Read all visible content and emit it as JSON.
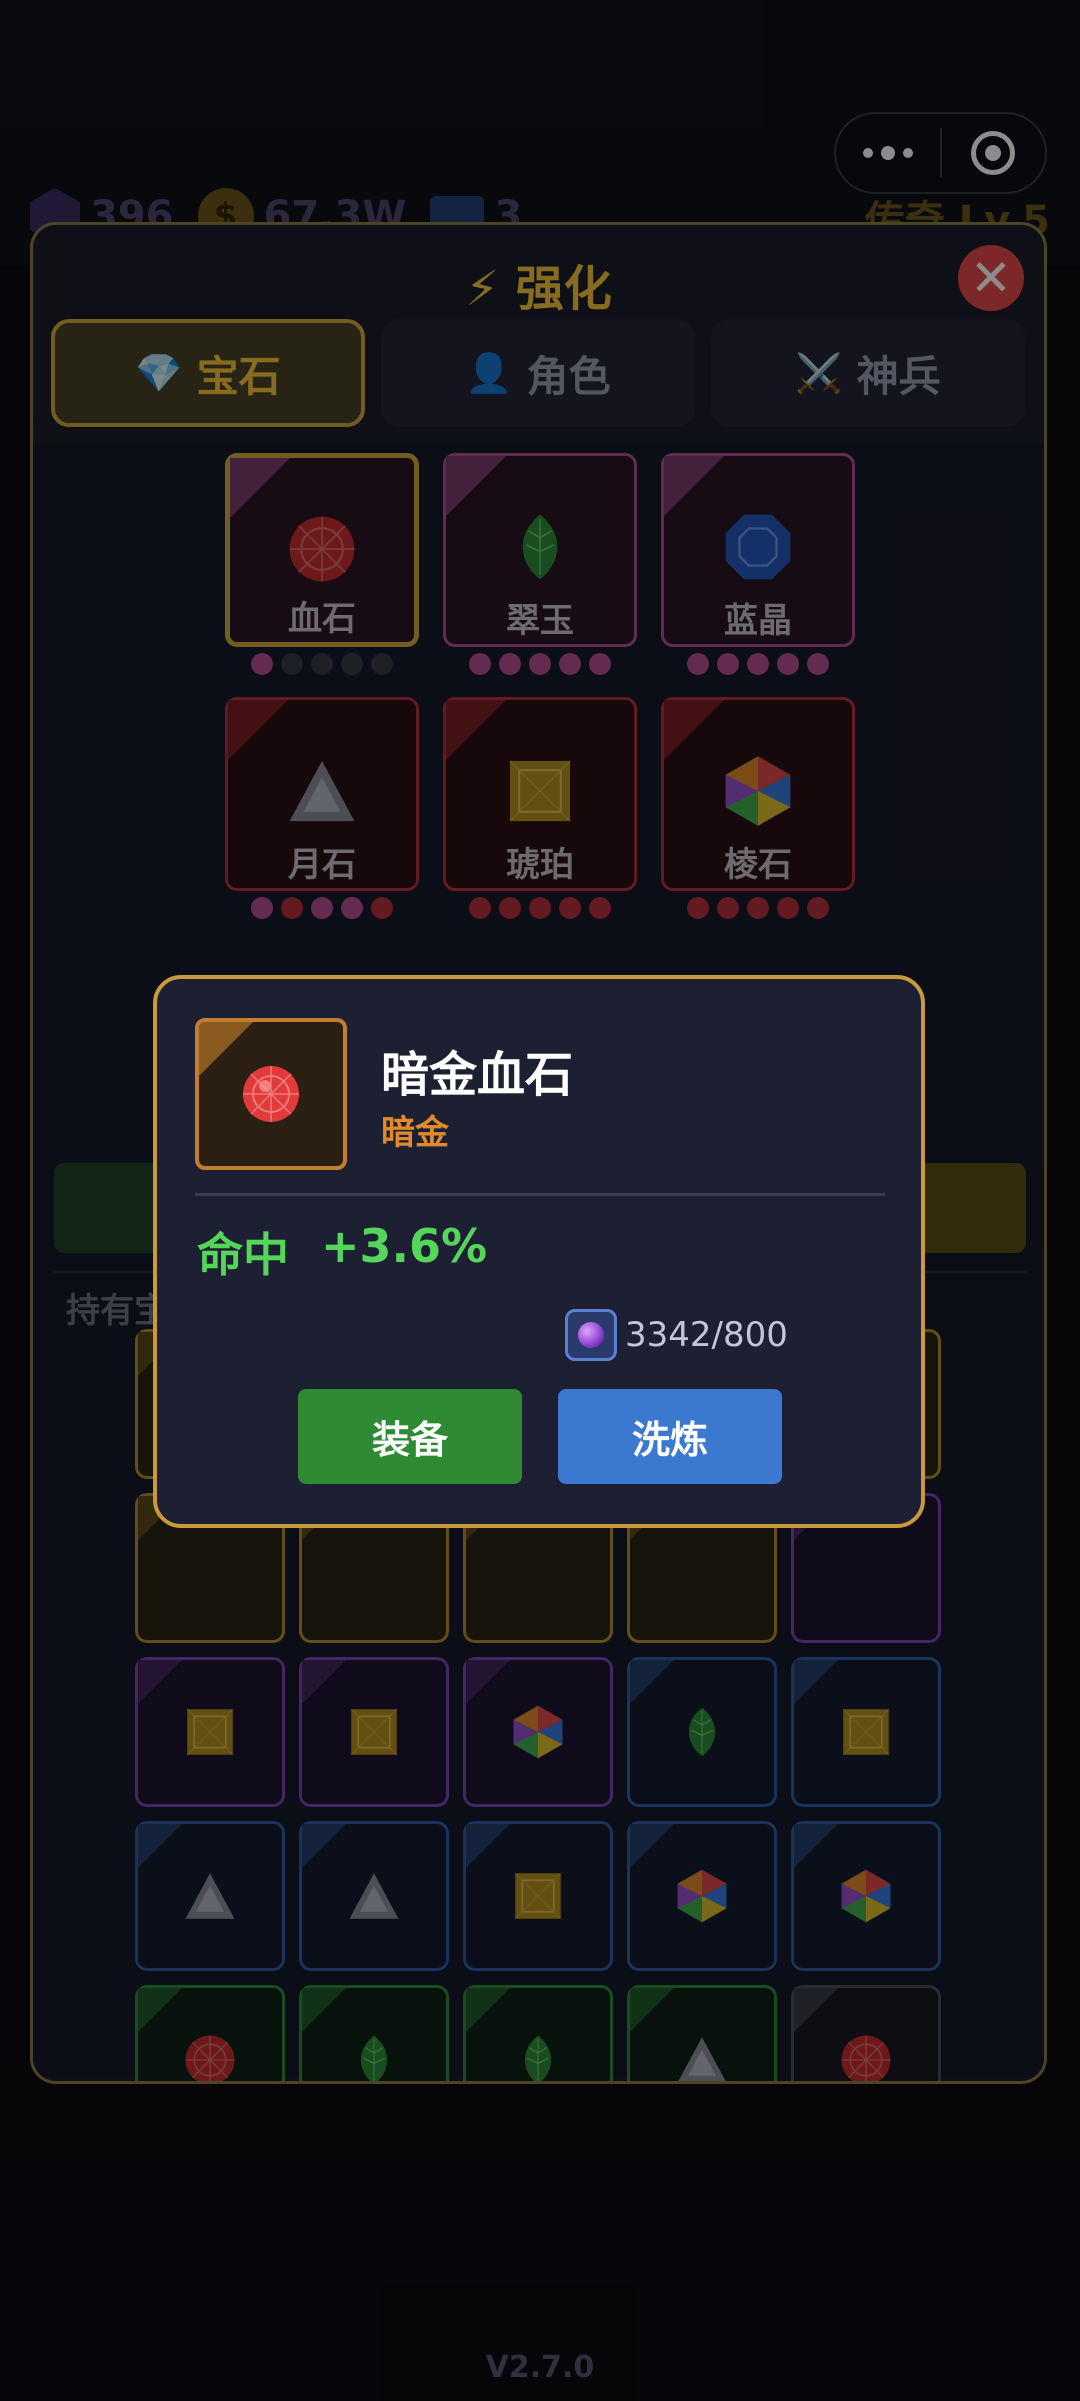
{
  "resources": {
    "gems": "396",
    "gold": "67.3W",
    "tickets": "3",
    "coin_symbol": "$"
  },
  "rank": "传奇 Lv.5",
  "panel": {
    "title": "⚡ 强化",
    "close_label": "✕",
    "tabs": [
      {
        "icon": "💎",
        "label": "宝石",
        "active": true
      },
      {
        "icon": "👤",
        "label": "角色",
        "active": false
      },
      {
        "icon": "⚔️",
        "label": "神兵",
        "active": false
      }
    ]
  },
  "gem_slots": [
    {
      "name": "血石",
      "icon": "ruby-icon",
      "color": "pink",
      "selected": true,
      "pips": [
        1,
        0,
        0,
        0,
        0
      ]
    },
    {
      "name": "翠玉",
      "icon": "leaf-icon",
      "color": "pink",
      "selected": false,
      "pips": [
        1,
        1,
        1,
        1,
        1
      ]
    },
    {
      "name": "蓝晶",
      "icon": "octagon-gem-icon",
      "color": "pink",
      "selected": false,
      "pips": [
        1,
        1,
        1,
        1,
        1
      ]
    },
    {
      "name": "月石",
      "icon": "triangle-gem-icon",
      "color": "red",
      "selected": false,
      "pips": [
        2,
        1,
        2,
        2,
        1
      ]
    },
    {
      "name": "琥珀",
      "icon": "square-gem-icon",
      "color": "red",
      "selected": false,
      "pips": [
        1,
        1,
        1,
        1,
        1
      ]
    },
    {
      "name": "棱石",
      "icon": "hexagon-gem-icon",
      "color": "red",
      "selected": false,
      "pips": [
        1,
        1,
        1,
        1,
        1
      ]
    }
  ],
  "held_label": "持有宝",
  "inventory": [
    [
      "gold",
      "gold",
      "gold",
      "gold",
      "gold"
    ],
    [
      "gold",
      "gold",
      "gold",
      "gold",
      "purple"
    ],
    [
      "purple",
      "purple",
      "purple",
      "blue",
      "blue"
    ],
    [
      "blue",
      "blue",
      "blue",
      "blue",
      "blue"
    ],
    [
      "green",
      "green",
      "green",
      "green",
      "gray"
    ],
    [
      "gray",
      "gray",
      "gray",
      "gray",
      "gray"
    ]
  ],
  "inventory_icons": [
    [
      "",
      "",
      "",
      "",
      ""
    ],
    [
      "",
      "",
      "",
      "",
      ""
    ],
    [
      "square",
      "square",
      "hexagon",
      "leaf",
      "square"
    ],
    [
      "triangle",
      "triangle",
      "square",
      "hexagon",
      "hexagon"
    ],
    [
      "ruby",
      "leaf",
      "leaf",
      "triangle",
      "ruby"
    ],
    [
      "ruby",
      "leaf",
      "leaf",
      "leaf",
      "octagon"
    ]
  ],
  "popup": {
    "name": "暗金血石",
    "grade": "暗金",
    "stat_name": "命中",
    "stat_value": "+3.6%",
    "cost": "3342/800",
    "equip_label": "装备",
    "refine_label": "洗炼"
  },
  "version": "V2.7.0",
  "colors": {
    "accent_gold": "#f6c33a",
    "close_red": "#e24a4a",
    "stat_green": "#55d65a",
    "equip_green": "#2f8a34",
    "refine_blue": "#3b78d0"
  }
}
